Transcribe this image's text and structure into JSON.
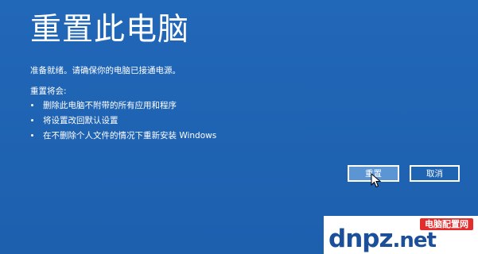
{
  "screen": {
    "title": "重置此电脑",
    "subtitle": "准备就绪。请确保你的电脑已接通电源。",
    "section_label": "重置将会:",
    "bullets": [
      "删除此电脑不附带的所有应用和程序",
      "将设置改回默认设置",
      "在不删除个人文件的情况下重新安装 Windows"
    ],
    "buttons": {
      "reset_label": "重置",
      "cancel_label": "取消"
    },
    "colors": {
      "background": "#1f63b3",
      "primary_button": "#5b95d3",
      "text": "#ffffff"
    }
  },
  "watermark": {
    "site_name": "电脑配置网",
    "logo_text": "dnpz",
    "logo_tld": ".net"
  }
}
